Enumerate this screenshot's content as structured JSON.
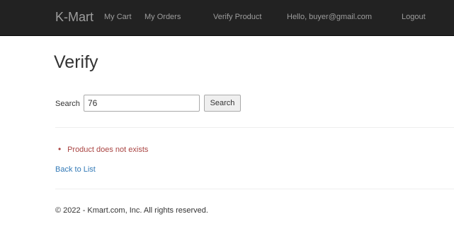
{
  "navbar": {
    "brand": "K-Mart",
    "links": {
      "my_cart": "My Cart",
      "my_orders": "My Orders",
      "verify_product": "Verify Product",
      "hello_user": "Hello, buyer@gmail.com",
      "logout": "Logout"
    }
  },
  "page": {
    "title": "Verify"
  },
  "search": {
    "label": "Search",
    "value": "76",
    "button_label": "Search"
  },
  "errors": {
    "bullet": "•",
    "message": "Product does not exists"
  },
  "back_link": "Back to List",
  "footer": {
    "text": "© 2022 - Kmart.com, Inc. All rights reserved."
  },
  "colors": {
    "navbar_bg": "#222222",
    "nav_text": "#9d9d9d",
    "error": "#a94442",
    "link": "#337ab7"
  }
}
